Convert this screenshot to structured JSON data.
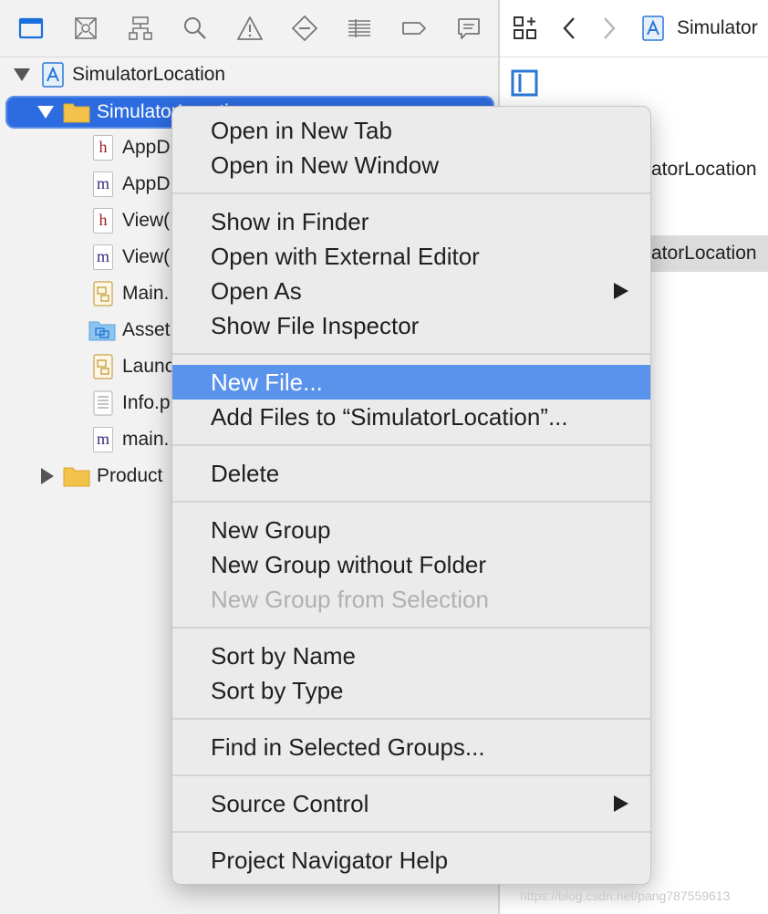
{
  "navigator": {
    "toolbar_icons": [
      "project-navigator-icon",
      "source-control-icon",
      "symbol-navigator-icon",
      "search-icon",
      "issue-warning-icon",
      "test-navigator-icon",
      "debug-navigator-icon",
      "breakpoint-icon",
      "report-icon"
    ],
    "tree": [
      {
        "label": "SimulatorLocation",
        "kind": "project",
        "expanded": true
      },
      {
        "label": "SimulatorLocation",
        "kind": "group",
        "expanded": true,
        "selected": true
      },
      {
        "label": "AppD",
        "kind": "h"
      },
      {
        "label": "AppD",
        "kind": "m"
      },
      {
        "label": "View(",
        "kind": "h"
      },
      {
        "label": "View(",
        "kind": "m"
      },
      {
        "label": "Main.",
        "kind": "storyboard"
      },
      {
        "label": "Asset",
        "kind": "assets"
      },
      {
        "label": "Launc",
        "kind": "storyboard"
      },
      {
        "label": "Info.p",
        "kind": "plist"
      },
      {
        "label": "main.",
        "kind": "m"
      },
      {
        "label": "Product",
        "kind": "group",
        "expanded": false
      }
    ]
  },
  "editor": {
    "breadcrumb_title": "Simulator",
    "rows": [
      "atorLocation",
      "atorLocation"
    ]
  },
  "context_menu": {
    "groups": [
      [
        {
          "label": "Open in New Tab"
        },
        {
          "label": "Open in New Window"
        }
      ],
      [
        {
          "label": "Show in Finder"
        },
        {
          "label": "Open with External Editor"
        },
        {
          "label": "Open As",
          "submenu": true
        },
        {
          "label": "Show File Inspector"
        }
      ],
      [
        {
          "label": "New File...",
          "highlighted": true
        },
        {
          "label": "Add Files to “SimulatorLocation”..."
        }
      ],
      [
        {
          "label": "Delete"
        }
      ],
      [
        {
          "label": "New Group"
        },
        {
          "label": "New Group without Folder"
        },
        {
          "label": "New Group from Selection",
          "disabled": true
        }
      ],
      [
        {
          "label": "Sort by Name"
        },
        {
          "label": "Sort by Type"
        }
      ],
      [
        {
          "label": "Find in Selected Groups..."
        }
      ],
      [
        {
          "label": "Source Control",
          "submenu": true
        }
      ],
      [
        {
          "label": "Project Navigator Help"
        }
      ]
    ]
  },
  "watermark": "https://blog.csdn.net/pang787559613",
  "colors": {
    "selection": "#2d6ce0",
    "highlight": "#5a93ec",
    "folder": "#f3c24a",
    "accent": "#1a6fdc"
  }
}
